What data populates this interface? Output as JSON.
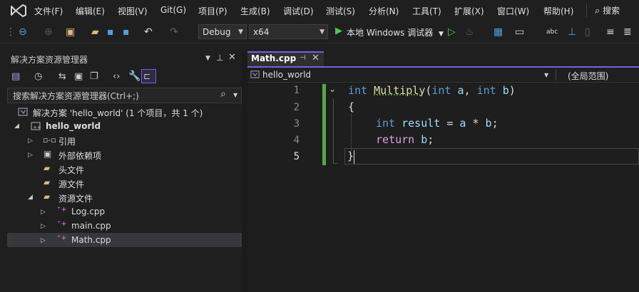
{
  "menu": {
    "items": [
      "文件(F)",
      "编辑(E)",
      "视图(V)",
      "Git(G)",
      "项目(P)",
      "生成(B)",
      "调试(D)",
      "测试(S)",
      "分析(N)",
      "工具(T)",
      "扩展(X)",
      "窗口(W)",
      "帮助(H)"
    ],
    "search": "搜索"
  },
  "toolbar": {
    "config": "Debug",
    "platform": "x64",
    "debugger": "本地 Windows 调试器"
  },
  "solution_explorer": {
    "title": "解决方案资源管理器",
    "search_placeholder": "搜索解决方案资源管理器(Ctrl+;)",
    "tree": {
      "solution": "解决方案 'hello_world' (1 个项目，共 1 个)",
      "project": "hello_world",
      "references": "引用",
      "external": "外部依赖项",
      "headers": "头文件",
      "source": "源文件",
      "resources": "资源文件",
      "file1": "Log.cpp",
      "file2": "main.cpp",
      "file3": "Math.cpp"
    }
  },
  "editor": {
    "tab": "Math.cpp",
    "scope_left": "hello_world",
    "scope_right": "(全局范围)",
    "line_numbers": [
      "1",
      "2",
      "3",
      "4",
      "5"
    ],
    "code": {
      "l1_kw": "int",
      "l1_fn": "Multiply",
      "l1_p1": "(",
      "l1_t1": "int",
      "l1_a": "a",
      "l1_c": ",",
      "l1_t2": "int",
      "l1_b": "b",
      "l1_p2": ")",
      "l2": "{",
      "l3_kw": "int",
      "l3_var": "result",
      "l3_eq": "=",
      "l3_a": "a",
      "l3_mul": "*",
      "l3_b": "b",
      "l3_semi": ";",
      "l4_kw": "return",
      "l4_b": "b",
      "l4_semi": ";",
      "l5": "}"
    }
  },
  "colors": {
    "accent": "#7160e8",
    "keyword": "#569cd6",
    "function": "#dcdcaa",
    "variable": "#9cdcfe",
    "control": "#d8a0df",
    "changed": "#57a64a"
  }
}
